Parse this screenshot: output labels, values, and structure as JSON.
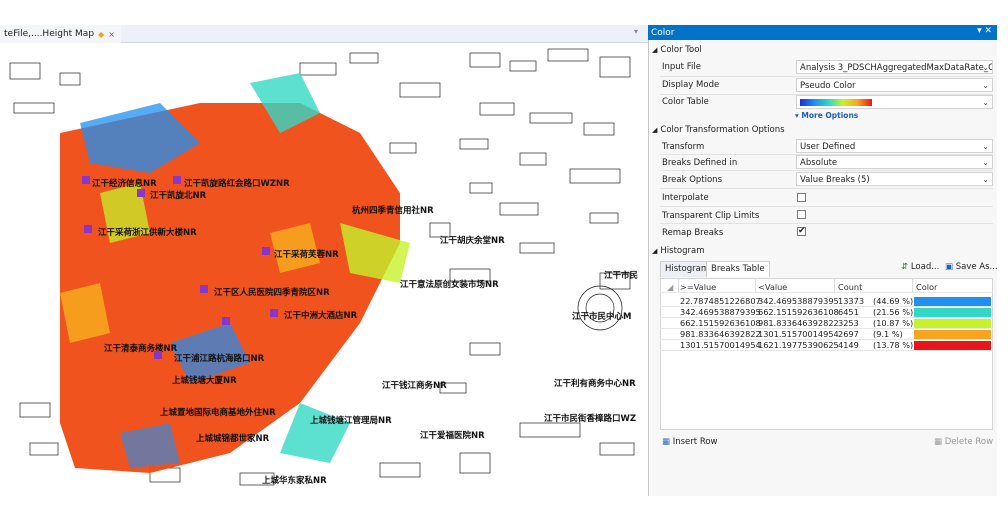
{
  "map_tab": {
    "title": "teFile,....Height Map",
    "dot": "◆",
    "close": "×"
  },
  "tab_dropdown": "▾",
  "map_labels": [
    "江干经济信息NR",
    "江干凯旋路红会路口WZNR",
    "江干凯旋北NR",
    "杭州四季青信用社NR",
    "江干采荷浙江供新大楼NR",
    "江干胡庆余堂NR",
    "江干采荷芙蓉NR",
    "江干市民",
    "江干意法原创女装市场NR",
    "江干区人民医院四季青院区NR",
    "江干市民中心M",
    "江干中洲大酒店NR",
    "江干浦江路杭海路口NR",
    "江干清泰商务楼NR",
    "上城钱塘大厦NR",
    "江干利有商务中心NR",
    "江干钱江商务NR",
    "上城置地国际电商基地外住NR",
    "上城钱塘江管理局NR",
    "江干市民街香樟路口WZ",
    "上城城锦都世家NR",
    "江干爱福医院NR",
    "上城华东家私NR"
  ],
  "panel": {
    "title": "Color",
    "title_icons": "▾ ✕",
    "color_tool": {
      "section": "Color Tool",
      "input_file_label": "Input File",
      "input_file_value": "Analysis 3_PDSCHAggregatedMaxDataRate_Com",
      "display_mode_label": "Display Mode",
      "display_mode_value": "Pseudo Color",
      "color_table_label": "Color Table",
      "more_options": "▾ More Options"
    },
    "transform": {
      "section": "Color Transformation Options",
      "transform_label": "Transform",
      "transform_value": "User Defined",
      "breaks_defined_label": "Breaks Defined in",
      "breaks_defined_value": "Absolute",
      "break_options_label": "Break Options",
      "break_options_value": "Value Breaks (5)",
      "interpolate_label": "Interpolate",
      "interpolate_checked": false,
      "transparent_label": "Transparent Clip Limits",
      "transparent_checked": false,
      "remap_label": "Remap Breaks",
      "remap_checked": true,
      "check_mark": "✔"
    },
    "histogram": {
      "section": "Histogram",
      "tab_histogram": "Histogram",
      "tab_breaks": "Breaks Table",
      "load": "Load...",
      "save_as": "Save As...",
      "columns": [
        ">=Value",
        "<Value",
        "Count",
        "Color"
      ],
      "rows": [
        {
          "ge": "22.7874851226807",
          "lt": "342.469538879395",
          "count": "13373",
          "pct": "(44.69 %)",
          "color": "#1f8ff2"
        },
        {
          "ge": "342.469538879395",
          "lt": "662.151592636108",
          "count": "6451",
          "pct": "(21.56 %)",
          "color": "#33d8c4"
        },
        {
          "ge": "662.151592636108",
          "lt": "981.833646392822",
          "count": "3253",
          "pct": "(10.87 %)",
          "color": "#c6f22a"
        },
        {
          "ge": "981.833646392822",
          "lt": "1301.51570014954",
          "count": "2697",
          "pct": "(9.1 %)",
          "color": "#f7a51e"
        },
        {
          "ge": "1301.51570014954",
          "lt": "1621.19775390625",
          "count": "4149",
          "pct": "(13.78 %)",
          "color": "#e8161a"
        }
      ],
      "insert_row": "Insert Row",
      "delete_row": "Delete Row"
    }
  }
}
